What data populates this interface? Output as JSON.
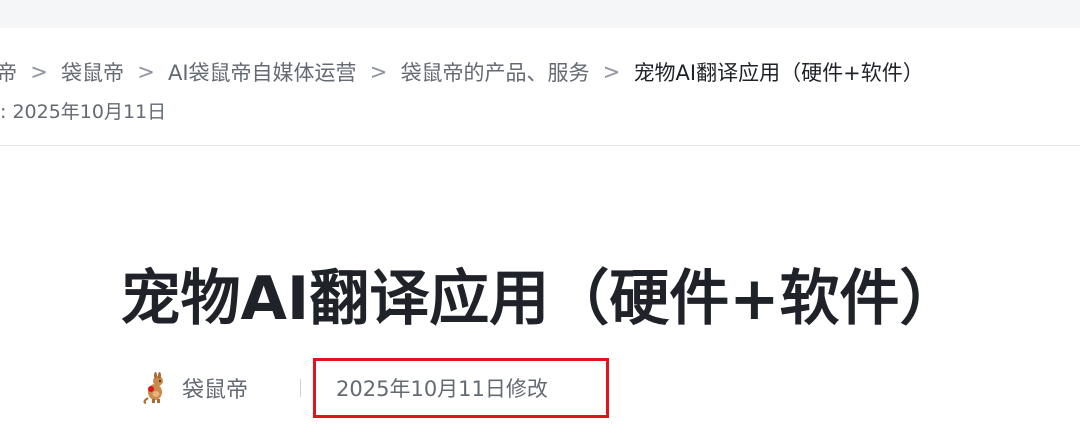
{
  "breadcrumb": {
    "items": [
      "帝",
      "袋鼠帝",
      "AI袋鼠帝自媒体运营",
      "袋鼠帝的产品、服务"
    ],
    "current": "宠物AI翻译应用（硬件+软件）",
    "separator": ">"
  },
  "last_updated": ": 2025年10月11日",
  "document": {
    "title": "宠物AI翻译应用（硬件+软件）",
    "author": "袋鼠帝",
    "author_avatar_icon": "kangaroo-icon",
    "modified": "2025年10月11日修改"
  },
  "colors": {
    "highlight_box": "#e0141a",
    "text_primary": "#1f2329",
    "text_secondary": "#646a73"
  }
}
